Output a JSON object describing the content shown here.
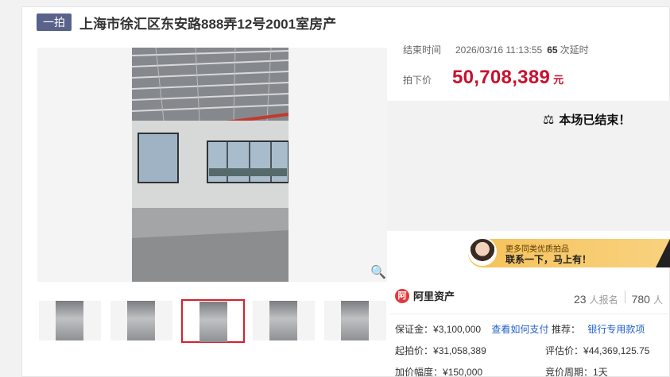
{
  "header": {
    "badge": "一拍",
    "title": "上海市徐汇区东安路888弄12号2001室房产"
  },
  "auction": {
    "end_time_label": "结束时间",
    "end_time": "2026/03/16 11:13:55",
    "delay_count": "65",
    "delay_label": "次延时",
    "price_label": "拍下价",
    "price": "50,708,389",
    "price_unit": "元",
    "ended_text": "本场已结束！"
  },
  "promo": {
    "small": "更多同类优质拍品",
    "large": "联系一下，马上有！"
  },
  "seller": {
    "logo_text": "阿",
    "name": "阿里资产",
    "enrolled_count": "23",
    "enrolled_label": "人报名",
    "watch_count": "780",
    "watch_label": "人"
  },
  "details": {
    "deposit_label": "保证金：",
    "deposit": "¥3,100,000",
    "payment_link": "查看如何支付",
    "recommend_label": "推荐：",
    "recommend_link": "银行专用款项",
    "start_price_label": "起拍价：",
    "start_price": "¥31,058,389",
    "appraisal_label": "评估价：",
    "appraisal": "¥44,369,125.75",
    "increment_label": "加价幅度：",
    "increment": "¥150,000",
    "cycle_label": "竞价周期：",
    "cycle": "1天"
  },
  "colors": {
    "accent_red": "#c8102e",
    "badge_bg": "#58628a",
    "link_blue": "#2462c9"
  },
  "icons": {
    "zoom": "magnifier-icon",
    "hammer": "gavel-icon"
  }
}
